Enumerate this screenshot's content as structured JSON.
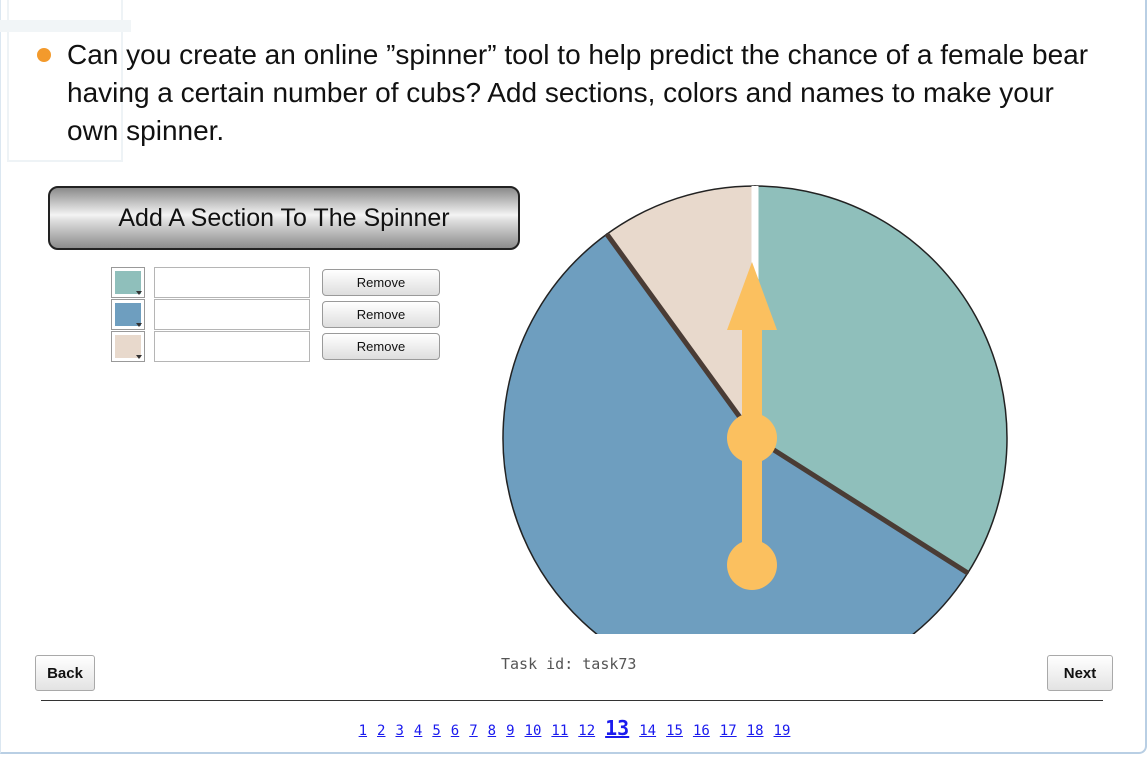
{
  "prompt": {
    "text": "Can you create an online ”spinner” tool to help predict the chance of a female bear having a certain number of cubs? Add sections, colors and names to make your own spinner.",
    "bullet_color": "#f39a2c"
  },
  "controls": {
    "add_section_label": "Add A Section To The Spinner",
    "sections": [
      {
        "color": "#8fbfbb",
        "name": "",
        "remove_label": "Remove"
      },
      {
        "color": "#6e9ebf",
        "name": "",
        "remove_label": "Remove"
      },
      {
        "color": "#e8d9cc",
        "name": "",
        "remove_label": "Remove"
      }
    ]
  },
  "spinner": {
    "sections": [
      {
        "color": "#8fbfbb",
        "fraction": 0.34
      },
      {
        "color": "#6e9ebf",
        "fraction": 0.56
      },
      {
        "color": "#e8d9cc",
        "fraction": 0.1
      }
    ],
    "arrow_color": "#fbc05f",
    "divider_color": "#4a3c35"
  },
  "footer": {
    "back_label": "Back",
    "next_label": "Next",
    "task_id": "Task id: task73",
    "pages": [
      "1",
      "2",
      "3",
      "4",
      "5",
      "6",
      "7",
      "8",
      "9",
      "10",
      "11",
      "12",
      "13",
      "14",
      "15",
      "16",
      "17",
      "18",
      "19"
    ],
    "current_page": "13"
  }
}
